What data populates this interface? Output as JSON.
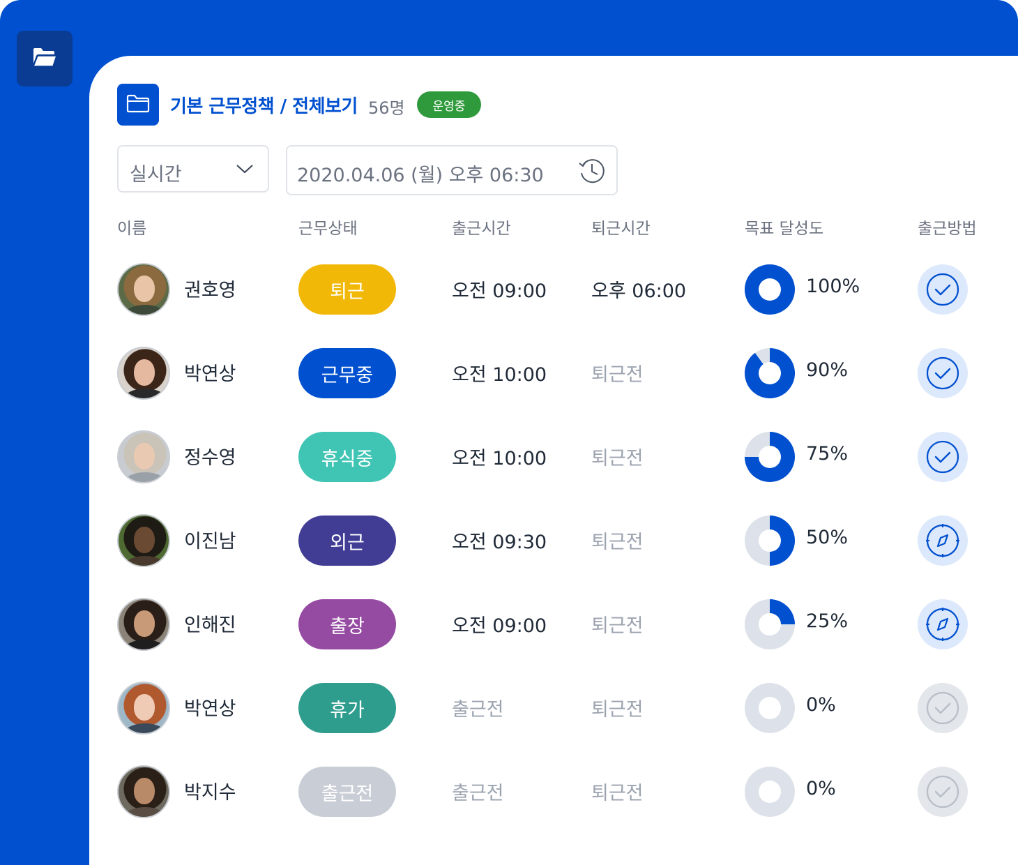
{
  "header": {
    "title": "기본 근무정책 / 전체보기",
    "count": "56명",
    "badge": "운영중"
  },
  "filters": {
    "mode": "실시간",
    "datetime": "2020.04.06 (월) 오후 06:30"
  },
  "columns": {
    "name": "이름",
    "status": "근무상태",
    "in": "출근시간",
    "out": "퇴근시간",
    "goal": "목표 달성도",
    "method": "출근방법"
  },
  "colors": {
    "brand": "#0050D0",
    "sidebar_button": "#0A3C93",
    "running_badge": "#2F9A3C",
    "donut_track": "#DDE2EA",
    "method_active_bg": "#DCE8FB",
    "method_inactive_bg": "#E3E6EA"
  },
  "rows": [
    {
      "name": "권호영",
      "status": "퇴근",
      "status_color": "#F2B807",
      "in": "오전 09:00",
      "in_muted": false,
      "out": "오후 06:00",
      "out_muted": false,
      "goal": 100,
      "goal_label": "100%",
      "method_icon": "check-circle-icon",
      "method_active": true
    },
    {
      "name": "박연상",
      "status": "근무중",
      "status_color": "#0050D0",
      "in": "오전 10:00",
      "in_muted": false,
      "out": "퇴근전",
      "out_muted": true,
      "goal": 90,
      "goal_label": "90%",
      "method_icon": "check-circle-icon",
      "method_active": true
    },
    {
      "name": "정수영",
      "status": "휴식중",
      "status_color": "#40C4B4",
      "in": "오전 10:00",
      "in_muted": false,
      "out": "퇴근전",
      "out_muted": true,
      "goal": 75,
      "goal_label": "75%",
      "method_icon": "check-circle-icon",
      "method_active": true
    },
    {
      "name": "이진남",
      "status": "외근",
      "status_color": "#413D94",
      "in": "오전 09:30",
      "in_muted": false,
      "out": "퇴근전",
      "out_muted": true,
      "goal": 50,
      "goal_label": "50%",
      "method_icon": "compass-icon",
      "method_active": true
    },
    {
      "name": "인해진",
      "status": "출장",
      "status_color": "#964BA3",
      "in": "오전 09:00",
      "in_muted": false,
      "out": "퇴근전",
      "out_muted": true,
      "goal": 25,
      "goal_label": "25%",
      "method_icon": "compass-icon",
      "method_active": true
    },
    {
      "name": "박연상",
      "status": "휴가",
      "status_color": "#2F9D8E",
      "in": "출근전",
      "in_muted": true,
      "out": "퇴근전",
      "out_muted": true,
      "goal": 0,
      "goal_label": "0%",
      "method_icon": "check-circle-icon",
      "method_active": false
    },
    {
      "name": "박지수",
      "status": "출근전",
      "status_color": "#C9CED6",
      "in": "출근전",
      "in_muted": true,
      "out": "퇴근전",
      "out_muted": true,
      "goal": 0,
      "goal_label": "0%",
      "method_icon": "check-circle-icon",
      "method_active": false
    }
  ]
}
